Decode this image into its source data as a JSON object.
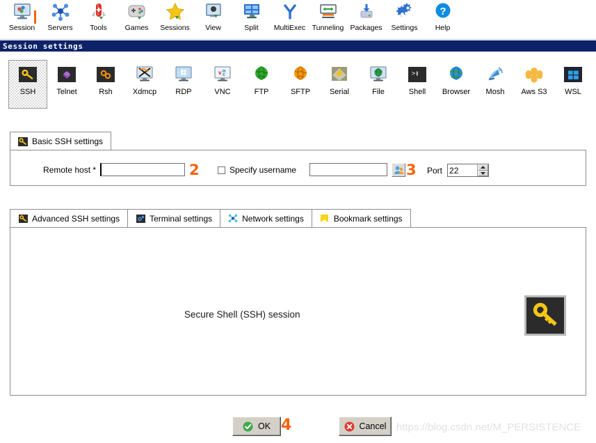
{
  "window": {
    "title": "Session settings"
  },
  "toolbar": {
    "items": [
      {
        "label": "Session",
        "icon": "session-icon"
      },
      {
        "label": "Servers",
        "icon": "servers-icon"
      },
      {
        "label": "Tools",
        "icon": "tools-icon"
      },
      {
        "label": "Games",
        "icon": "games-icon"
      },
      {
        "label": "Sessions",
        "icon": "sessions-star-icon"
      },
      {
        "label": "View",
        "icon": "view-icon"
      },
      {
        "label": "Split",
        "icon": "split-icon"
      },
      {
        "label": "MultiExec",
        "icon": "multiexec-icon"
      },
      {
        "label": "Tunneling",
        "icon": "tunneling-icon"
      },
      {
        "label": "Packages",
        "icon": "packages-icon"
      },
      {
        "label": "Settings",
        "icon": "settings-gear-icon"
      },
      {
        "label": "Help",
        "icon": "help-icon"
      }
    ]
  },
  "session_types": {
    "selected": "SSH",
    "items": [
      {
        "label": "SSH",
        "icon": "ssh-key-icon"
      },
      {
        "label": "Telnet",
        "icon": "telnet-icon"
      },
      {
        "label": "Rsh",
        "icon": "rsh-icon"
      },
      {
        "label": "Xdmcp",
        "icon": "xdmcp-icon"
      },
      {
        "label": "RDP",
        "icon": "rdp-icon"
      },
      {
        "label": "VNC",
        "icon": "vnc-icon"
      },
      {
        "label": "FTP",
        "icon": "ftp-icon"
      },
      {
        "label": "SFTP",
        "icon": "sftp-icon"
      },
      {
        "label": "Serial",
        "icon": "serial-icon"
      },
      {
        "label": "File",
        "icon": "file-icon"
      },
      {
        "label": "Shell",
        "icon": "shell-icon"
      },
      {
        "label": "Browser",
        "icon": "browser-icon"
      },
      {
        "label": "Mosh",
        "icon": "mosh-icon"
      },
      {
        "label": "Aws S3",
        "icon": "aws-s3-icon"
      },
      {
        "label": "WSL",
        "icon": "wsl-icon"
      }
    ]
  },
  "basic_tab": {
    "label": "Basic SSH settings",
    "icon": "ssh-key-icon",
    "remote_host_label": "Remote host *",
    "remote_host_value": "",
    "remote_host_placeholder": "",
    "specify_username_label": "Specify username",
    "specify_username_checked": false,
    "username_value": "",
    "username_placeholder": "",
    "user_button_icon": "user-picker-icon",
    "port_label": "Port",
    "port_value": "22"
  },
  "settings_tabs": [
    {
      "label": "Advanced SSH settings",
      "icon": "ssh-key-icon"
    },
    {
      "label": "Terminal settings",
      "icon": "terminal-gear-icon"
    },
    {
      "label": "Network settings",
      "icon": "network-nodes-icon"
    },
    {
      "label": "Bookmark settings",
      "icon": "bookmark-icon"
    }
  ],
  "content": {
    "description": "Secure Shell (SSH) session",
    "key_icon": "ssh-key-large-icon"
  },
  "footer": {
    "ok_label": "OK",
    "ok_icon": "check-circle-icon",
    "cancel_label": "Cancel",
    "cancel_icon": "cancel-circle-icon",
    "watermark": "https://blog.csdn.net/M_PERSISTENCE"
  },
  "annotations": [
    {
      "text": "1",
      "note": "session-toolbar-marker"
    },
    {
      "text": "2",
      "note": "remote-host-marker"
    },
    {
      "text": "3",
      "note": "username-button-marker"
    },
    {
      "text": "4",
      "note": "ok-button-marker"
    }
  ],
  "colors": {
    "titlebar": "#0d2268",
    "annotation": "#f4630c",
    "key_yellow": "#f5c518",
    "accent_blue": "#2f6fd0"
  }
}
